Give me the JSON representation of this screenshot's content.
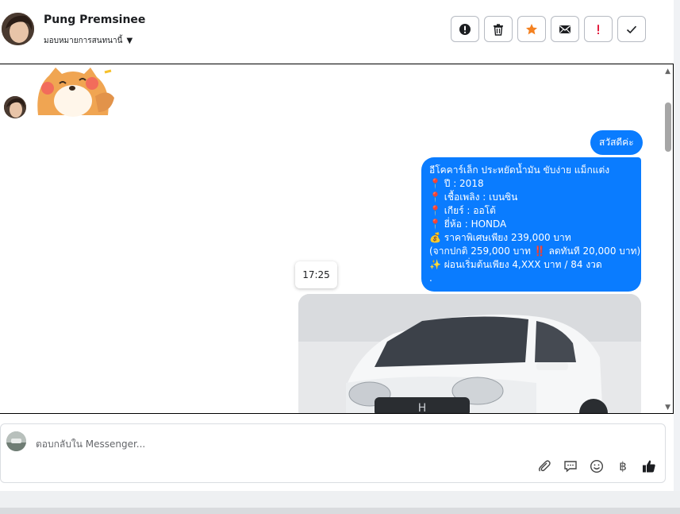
{
  "header": {
    "contact_name": "Pung Premsinee",
    "assign_label": "มอบหมายการสนทนานี้",
    "actions": [
      {
        "name": "report-button",
        "icon": "exclamation-circle-icon"
      },
      {
        "name": "delete-button",
        "icon": "trash-icon"
      },
      {
        "name": "star-button",
        "icon": "star-icon"
      },
      {
        "name": "mark-unread-button",
        "icon": "envelope-icon"
      },
      {
        "name": "follow-up-button",
        "icon": "exclamation-icon"
      },
      {
        "name": "done-button",
        "icon": "check-icon"
      }
    ]
  },
  "messages": {
    "greeting": "สวัสดีค่ะ",
    "listing": [
      "อีโคคาร์เล็ก ประหยัดน้ำมัน ขับง่าย แม็กแต่ง",
      "📍 ปี : 2018",
      "📍 เชื้อเพลิง : เบนซิน",
      "📍 เกียร์ : ออโต้",
      "📍 ยี่ห้อ : HONDA",
      "💰 ราคาพิเศษเพียง 239,000 บาท",
      "(จากปกติ 259,000 บาท ‼️ ลดทันที 20,000 บาท)",
      "✨ ผ่อนเริ่มต้นเพียง 4,XXX บาท / 84 งวด",
      "."
    ],
    "timestamp": "17:25"
  },
  "composer": {
    "placeholder": "ตอบกลับใน Messenger...",
    "tools": [
      "paperclip-icon",
      "chat-bubble-icon",
      "smiley-icon",
      "baht-icon",
      "thumbs-up-icon"
    ]
  },
  "colors": {
    "bubble": "#0a7cff",
    "star": "#f48120",
    "alert": "#e41e3f"
  }
}
